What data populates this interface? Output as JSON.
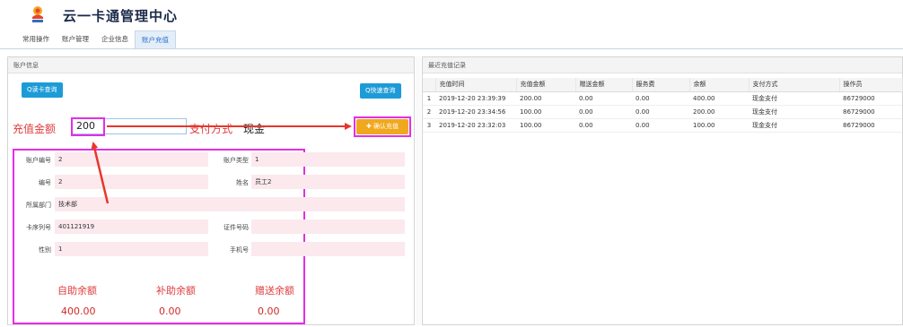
{
  "app": {
    "title": "云一卡通管理中心",
    "logo_icon": "user-badge-icon"
  },
  "tabs": [
    {
      "label": "常用操作",
      "active": false
    },
    {
      "label": "账户管理",
      "active": false
    },
    {
      "label": "企业信息",
      "active": false
    },
    {
      "label": "账户充值",
      "active": true
    }
  ],
  "left_panel": {
    "title": "账户信息",
    "read_card_button": "Q读卡查询",
    "quick_query_button": "Q快速查询",
    "amount_label": "充值金额",
    "amount_value": "200",
    "pay_method_label": "支付方式",
    "pay_method_value": "现金",
    "confirm_button": "✚ 确认充值",
    "fields": {
      "account_no": {
        "label": "账户编号",
        "value": "2"
      },
      "account_type": {
        "label": "账户类型",
        "value": "1"
      },
      "number": {
        "label": "编号",
        "value": "2"
      },
      "name": {
        "label": "姓名",
        "value": "员工2"
      },
      "department": {
        "label": "所属部门",
        "value": "技术部"
      },
      "card_serial": {
        "label": "卡序列号",
        "value": "401121919"
      },
      "id_number": {
        "label": "证件号码",
        "value": ""
      },
      "gender": {
        "label": "性别",
        "value": "1"
      },
      "phone": {
        "label": "手机号",
        "value": ""
      }
    },
    "balances": [
      {
        "label": "自助余额",
        "value": "400.00"
      },
      {
        "label": "补助余额",
        "value": "0.00"
      },
      {
        "label": "赠送余额",
        "value": "0.00"
      }
    ]
  },
  "right_panel": {
    "title": "最近充值记录",
    "columns": [
      "",
      "充值时间",
      "充值金额",
      "赠送金额",
      "服务费",
      "余额",
      "支付方式",
      "操作员"
    ],
    "rows": [
      [
        "1",
        "2019-12-20 23:39:39",
        "200.00",
        "0.00",
        "0.00",
        "400.00",
        "现金支付",
        "86729000"
      ],
      [
        "2",
        "2019-12-20 23:34:56",
        "100.00",
        "0.00",
        "0.00",
        "200.00",
        "现金支付",
        "86729000"
      ],
      [
        "3",
        "2019-12-20 23:32:03",
        "100.00",
        "0.00",
        "0.00",
        "100.00",
        "现金支付",
        "86729000"
      ]
    ]
  },
  "colors": {
    "accent_blue": "#1d9bd7",
    "confirm_orange": "#f0a81e",
    "highlight_magenta": "#e42ee4",
    "annotation_red": "#e03c3c"
  }
}
